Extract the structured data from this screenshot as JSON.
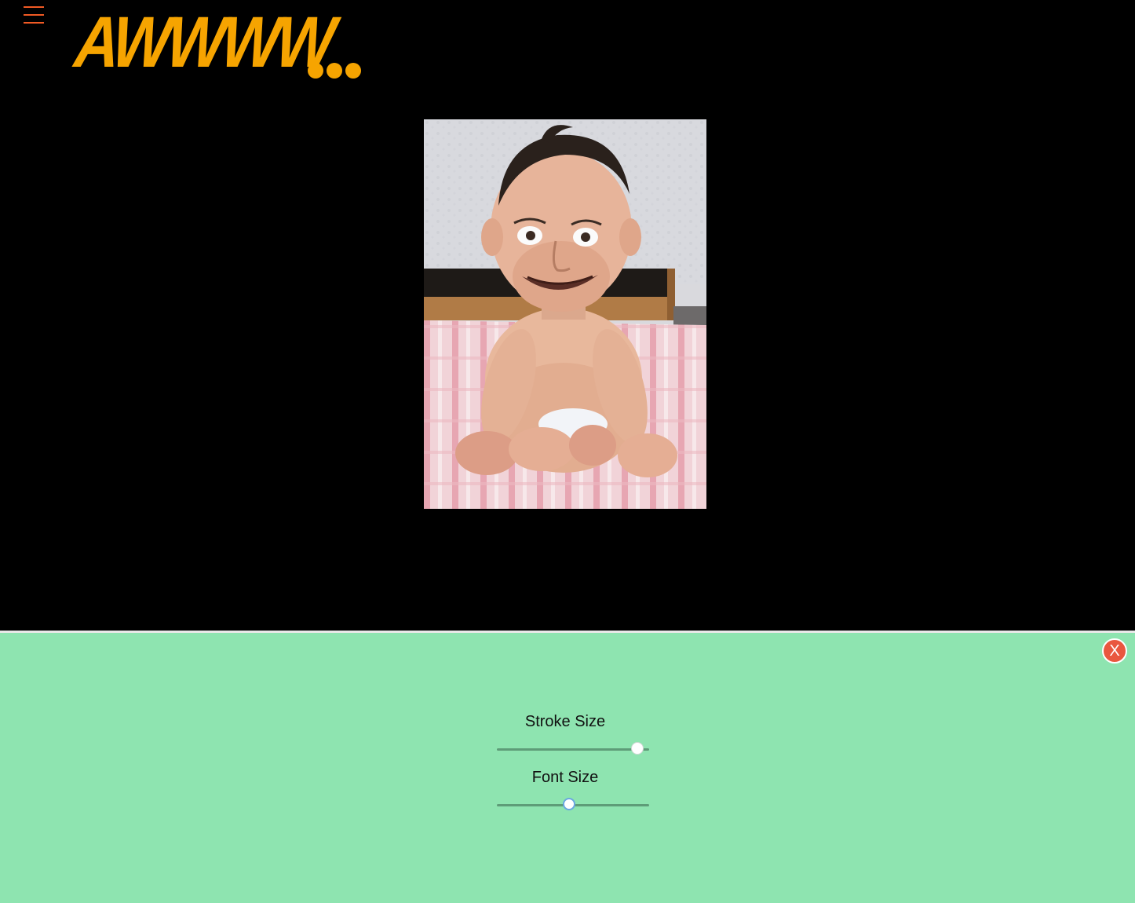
{
  "header": {
    "menu_icon": "hamburger-menu-icon",
    "logo_text": "AWWWW",
    "logo_color": "#f6a400",
    "menu_color": "#f05a24"
  },
  "main": {
    "image_subject": "baby-with-adult-face-on-bed"
  },
  "panel": {
    "background": "#8ee4b0",
    "close_label": "X",
    "close_color": "#e9573f",
    "stroke_size": {
      "label": "Stroke Size",
      "value_fraction": 0.96
    },
    "font_size": {
      "label": "Font Size",
      "value_fraction": 0.47
    }
  }
}
